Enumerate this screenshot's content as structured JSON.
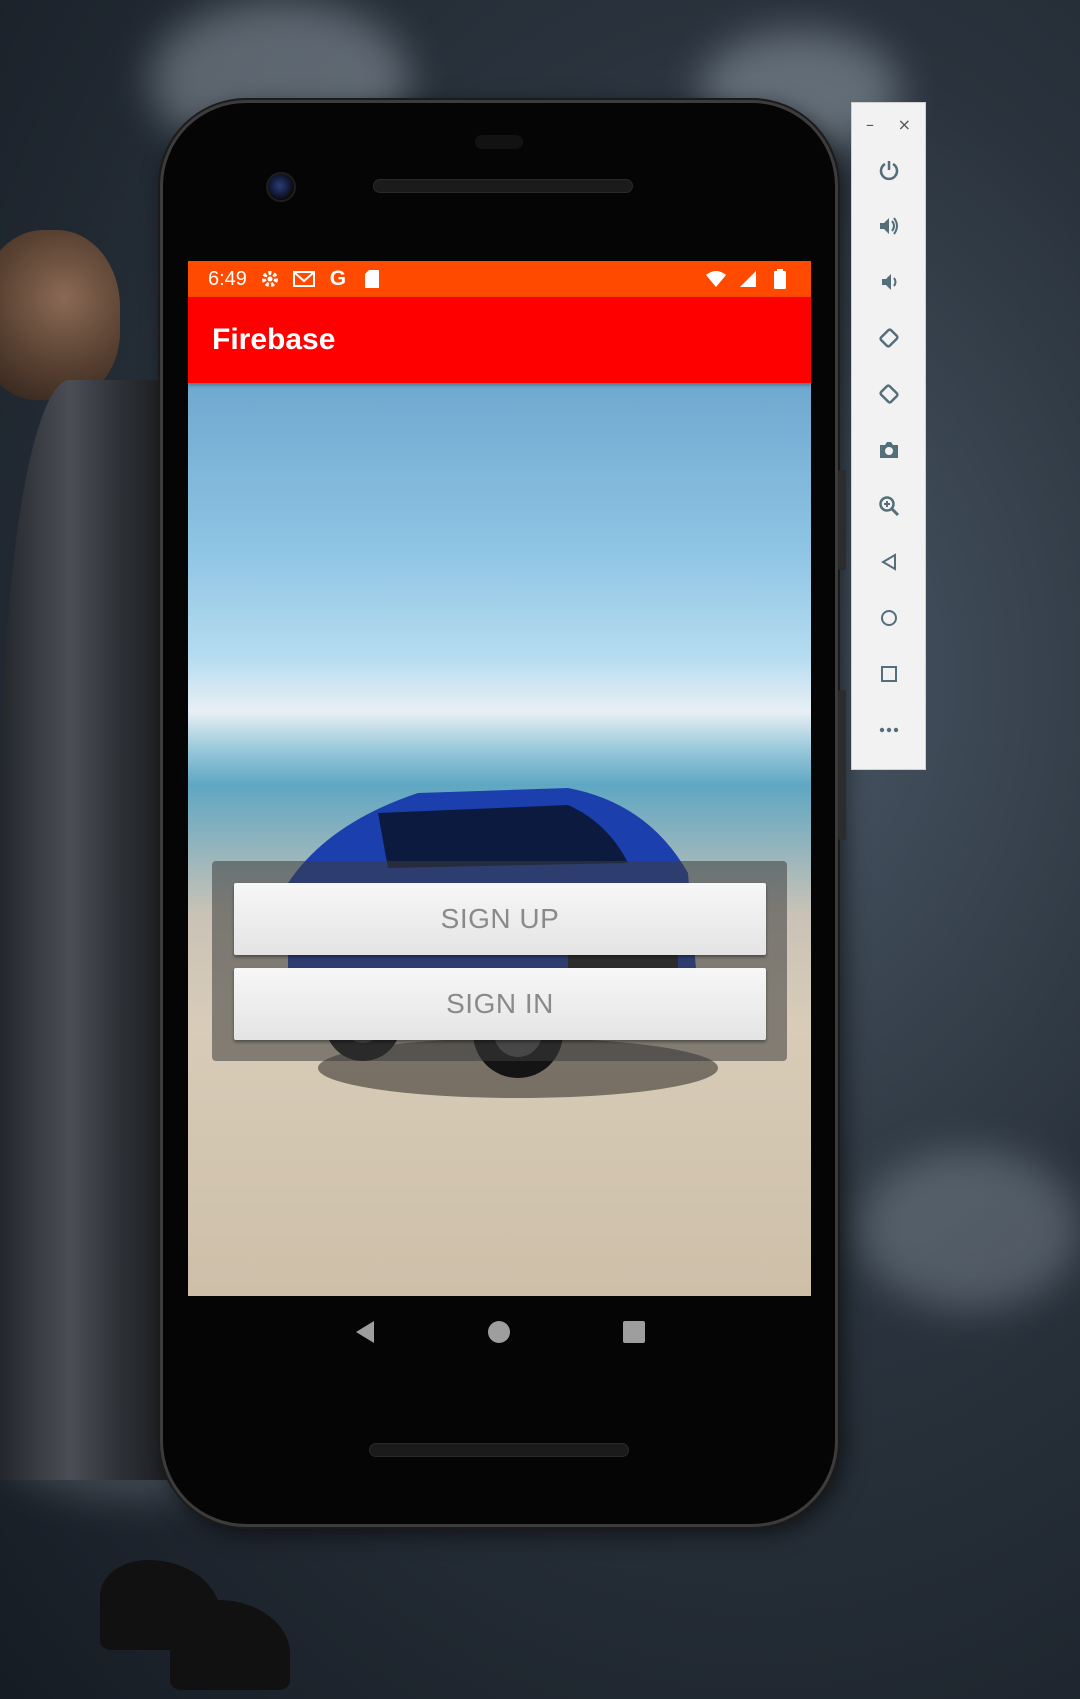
{
  "status_bar": {
    "time": "6:49",
    "left_icons": [
      "gear-icon",
      "gmail-icon",
      "google-icon",
      "sd-card-icon"
    ],
    "right_icons": [
      "wifi-icon",
      "signal-icon",
      "battery-icon"
    ],
    "color": "#ff4a00"
  },
  "app_bar": {
    "title": "Firebase",
    "color": "#ff0000"
  },
  "buttons": {
    "sign_up": "SIGN UP",
    "sign_in": "SIGN IN"
  },
  "nav_bar": [
    "back-icon",
    "home-icon",
    "recents-icon"
  ],
  "emulator_toolbar": {
    "window_controls": {
      "minimize": "–",
      "close": "×"
    },
    "items": [
      "power-icon",
      "volume-up-icon",
      "volume-down-icon",
      "rotate-left-icon",
      "rotate-right-icon",
      "camera-icon",
      "zoom-icon",
      "back-icon",
      "home-icon",
      "overview-icon",
      "more-icon"
    ]
  }
}
